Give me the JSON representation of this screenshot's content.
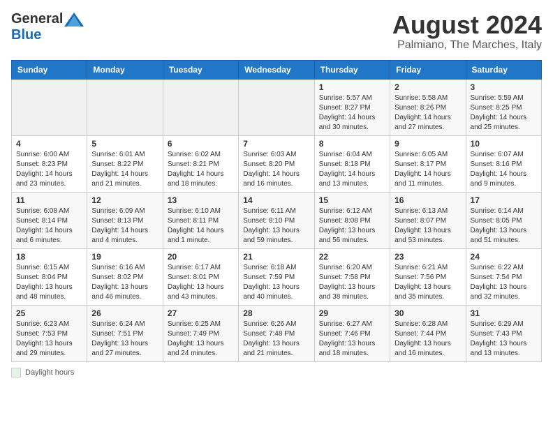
{
  "header": {
    "logo_general": "General",
    "logo_blue": "Blue",
    "month_year": "August 2024",
    "location": "Palmiano, The Marches, Italy"
  },
  "days_of_week": [
    "Sunday",
    "Monday",
    "Tuesday",
    "Wednesday",
    "Thursday",
    "Friday",
    "Saturday"
  ],
  "weeks": [
    [
      {
        "day": "",
        "info": ""
      },
      {
        "day": "",
        "info": ""
      },
      {
        "day": "",
        "info": ""
      },
      {
        "day": "",
        "info": ""
      },
      {
        "day": "1",
        "info": "Sunrise: 5:57 AM\nSunset: 8:27 PM\nDaylight: 14 hours and 30 minutes."
      },
      {
        "day": "2",
        "info": "Sunrise: 5:58 AM\nSunset: 8:26 PM\nDaylight: 14 hours and 27 minutes."
      },
      {
        "day": "3",
        "info": "Sunrise: 5:59 AM\nSunset: 8:25 PM\nDaylight: 14 hours and 25 minutes."
      }
    ],
    [
      {
        "day": "4",
        "info": "Sunrise: 6:00 AM\nSunset: 8:23 PM\nDaylight: 14 hours and 23 minutes."
      },
      {
        "day": "5",
        "info": "Sunrise: 6:01 AM\nSunset: 8:22 PM\nDaylight: 14 hours and 21 minutes."
      },
      {
        "day": "6",
        "info": "Sunrise: 6:02 AM\nSunset: 8:21 PM\nDaylight: 14 hours and 18 minutes."
      },
      {
        "day": "7",
        "info": "Sunrise: 6:03 AM\nSunset: 8:20 PM\nDaylight: 14 hours and 16 minutes."
      },
      {
        "day": "8",
        "info": "Sunrise: 6:04 AM\nSunset: 8:18 PM\nDaylight: 14 hours and 13 minutes."
      },
      {
        "day": "9",
        "info": "Sunrise: 6:05 AM\nSunset: 8:17 PM\nDaylight: 14 hours and 11 minutes."
      },
      {
        "day": "10",
        "info": "Sunrise: 6:07 AM\nSunset: 8:16 PM\nDaylight: 14 hours and 9 minutes."
      }
    ],
    [
      {
        "day": "11",
        "info": "Sunrise: 6:08 AM\nSunset: 8:14 PM\nDaylight: 14 hours and 6 minutes."
      },
      {
        "day": "12",
        "info": "Sunrise: 6:09 AM\nSunset: 8:13 PM\nDaylight: 14 hours and 4 minutes."
      },
      {
        "day": "13",
        "info": "Sunrise: 6:10 AM\nSunset: 8:11 PM\nDaylight: 14 hours and 1 minute."
      },
      {
        "day": "14",
        "info": "Sunrise: 6:11 AM\nSunset: 8:10 PM\nDaylight: 13 hours and 59 minutes."
      },
      {
        "day": "15",
        "info": "Sunrise: 6:12 AM\nSunset: 8:08 PM\nDaylight: 13 hours and 56 minutes."
      },
      {
        "day": "16",
        "info": "Sunrise: 6:13 AM\nSunset: 8:07 PM\nDaylight: 13 hours and 53 minutes."
      },
      {
        "day": "17",
        "info": "Sunrise: 6:14 AM\nSunset: 8:05 PM\nDaylight: 13 hours and 51 minutes."
      }
    ],
    [
      {
        "day": "18",
        "info": "Sunrise: 6:15 AM\nSunset: 8:04 PM\nDaylight: 13 hours and 48 minutes."
      },
      {
        "day": "19",
        "info": "Sunrise: 6:16 AM\nSunset: 8:02 PM\nDaylight: 13 hours and 46 minutes."
      },
      {
        "day": "20",
        "info": "Sunrise: 6:17 AM\nSunset: 8:01 PM\nDaylight: 13 hours and 43 minutes."
      },
      {
        "day": "21",
        "info": "Sunrise: 6:18 AM\nSunset: 7:59 PM\nDaylight: 13 hours and 40 minutes."
      },
      {
        "day": "22",
        "info": "Sunrise: 6:20 AM\nSunset: 7:58 PM\nDaylight: 13 hours and 38 minutes."
      },
      {
        "day": "23",
        "info": "Sunrise: 6:21 AM\nSunset: 7:56 PM\nDaylight: 13 hours and 35 minutes."
      },
      {
        "day": "24",
        "info": "Sunrise: 6:22 AM\nSunset: 7:54 PM\nDaylight: 13 hours and 32 minutes."
      }
    ],
    [
      {
        "day": "25",
        "info": "Sunrise: 6:23 AM\nSunset: 7:53 PM\nDaylight: 13 hours and 29 minutes."
      },
      {
        "day": "26",
        "info": "Sunrise: 6:24 AM\nSunset: 7:51 PM\nDaylight: 13 hours and 27 minutes."
      },
      {
        "day": "27",
        "info": "Sunrise: 6:25 AM\nSunset: 7:49 PM\nDaylight: 13 hours and 24 minutes."
      },
      {
        "day": "28",
        "info": "Sunrise: 6:26 AM\nSunset: 7:48 PM\nDaylight: 13 hours and 21 minutes."
      },
      {
        "day": "29",
        "info": "Sunrise: 6:27 AM\nSunset: 7:46 PM\nDaylight: 13 hours and 18 minutes."
      },
      {
        "day": "30",
        "info": "Sunrise: 6:28 AM\nSunset: 7:44 PM\nDaylight: 13 hours and 16 minutes."
      },
      {
        "day": "31",
        "info": "Sunrise: 6:29 AM\nSunset: 7:43 PM\nDaylight: 13 hours and 13 minutes."
      }
    ]
  ],
  "footer": {
    "label": "Daylight hours"
  }
}
